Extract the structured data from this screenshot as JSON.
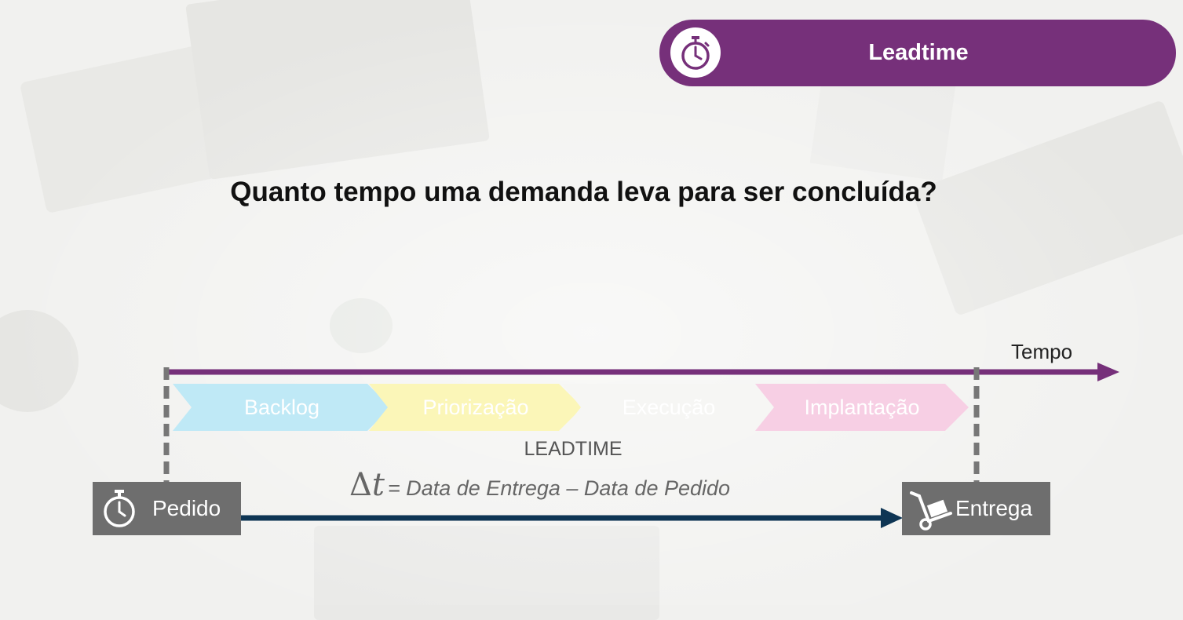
{
  "header": {
    "title": "Leadtime",
    "icon": "stopwatch-icon"
  },
  "question": "Quanto tempo uma demanda leva para ser concluída?",
  "timeline": {
    "axis_label": "Tempo",
    "stages": [
      {
        "label": "Backlog",
        "color": "#bfe9f6"
      },
      {
        "label": "Priorização",
        "color": "#fbf6b8"
      },
      {
        "label": "Execução",
        "color": "#f6f6f4"
      },
      {
        "label": "Implantação",
        "color": "#f7cfe4"
      }
    ],
    "span_label": "LEADTIME",
    "formula": {
      "delta": "Δ",
      "variable": "t",
      "expression": "= Data de Entrega – Data de Pedido"
    },
    "start": {
      "label": "Pedido",
      "icon": "stopwatch-icon"
    },
    "end": {
      "label": "Entrega",
      "icon": "hand-truck-icon"
    }
  },
  "colors": {
    "accent": "#76307a",
    "arrow_dark": "#0e3554",
    "box_grey": "#6e6e6e"
  }
}
